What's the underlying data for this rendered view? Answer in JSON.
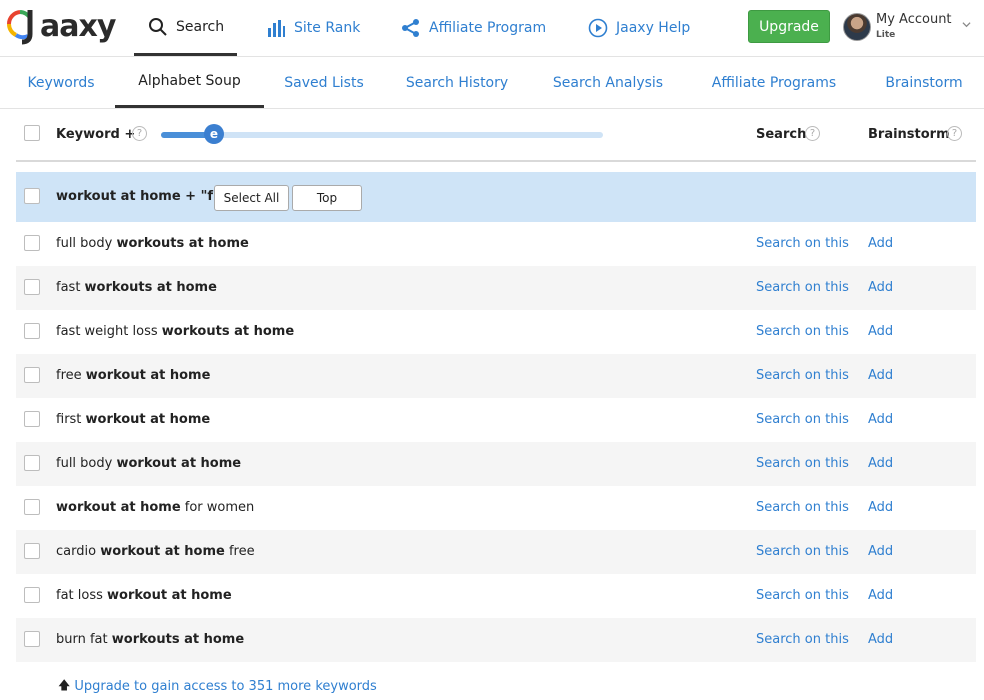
{
  "brand": {
    "name": "aaxy"
  },
  "nav": {
    "items": [
      {
        "label": "Search",
        "icon": "search-icon"
      },
      {
        "label": "Site Rank",
        "icon": "bar-chart-icon"
      },
      {
        "label": "Affiliate Program",
        "icon": "share-icon"
      },
      {
        "label": "Jaaxy Help",
        "icon": "play-circle-icon"
      }
    ],
    "upgrade_label": "Upgrade",
    "account_label": "My Account",
    "account_plan": "Lite"
  },
  "subtabs": [
    "Keywords",
    "Alphabet Soup",
    "Saved Lists",
    "Search History",
    "Search Analysis",
    "Affiliate Programs",
    "Brainstorm"
  ],
  "table": {
    "keyword_header": "Keyword +",
    "slider_letter": "e",
    "slider_level_percent": 12,
    "search_header": "Search",
    "brainstorm_header": "Brainstorm",
    "group_label": "workout at home + \"f\"",
    "select_all_label": "Select All",
    "top_label": "Top",
    "search_link_label": "Search on this",
    "add_link_label": "Add",
    "rows": [
      {
        "pre": "full body ",
        "bold": "workouts at home",
        "post": ""
      },
      {
        "pre": "fast ",
        "bold": "workouts at home",
        "post": ""
      },
      {
        "pre": "fast weight loss ",
        "bold": "workouts at home",
        "post": ""
      },
      {
        "pre": "free ",
        "bold": "workout at home",
        "post": ""
      },
      {
        "pre": "first ",
        "bold": "workout at home",
        "post": ""
      },
      {
        "pre": "full body ",
        "bold": "workout at home",
        "post": ""
      },
      {
        "pre": "",
        "bold": "workout at home",
        "post": " for women"
      },
      {
        "pre": "cardio ",
        "bold": "workout at home",
        "post": " free"
      },
      {
        "pre": "fat loss ",
        "bold": "workout at home",
        "post": ""
      },
      {
        "pre": "burn fat ",
        "bold": "workouts at home",
        "post": ""
      }
    ]
  },
  "upgrade_note": "Upgrade to gain access to 351 more keywords",
  "colors": {
    "link": "#2f7fd0",
    "upgrade": "#4bb04f",
    "highlight_row": "#cfe4f7",
    "slider": "#4a8fd8"
  }
}
